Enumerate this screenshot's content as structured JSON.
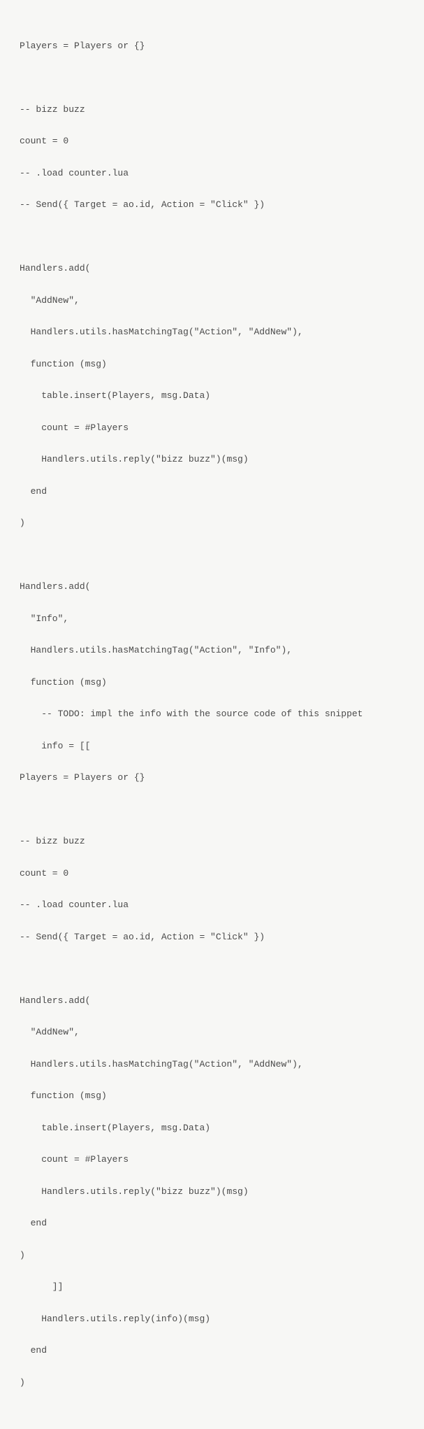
{
  "code": {
    "line1": "Players = Players or {}",
    "line2": "",
    "line3": "-- bizz buzz",
    "line4": "count = 0",
    "line5": "-- .load counter.lua",
    "line6": "-- Send({ Target = ao.id, Action = \"Click\" })",
    "line7": "",
    "line8": "Handlers.add(",
    "line9": "  \"AddNew\",",
    "line10": "  Handlers.utils.hasMatchingTag(\"Action\", \"AddNew\"),",
    "line11": "  function (msg)",
    "line12": "    table.insert(Players, msg.Data)",
    "line13": "    count = #Players",
    "line14": "    Handlers.utils.reply(\"bizz buzz\")(msg)",
    "line15": "  end",
    "line16": ")",
    "line17": "",
    "line18": "Handlers.add(",
    "line19": "  \"Info\",",
    "line20": "  Handlers.utils.hasMatchingTag(\"Action\", \"Info\"),",
    "line21": "  function (msg)",
    "line22": "    -- TODO: impl the info with the source code of this snippet",
    "line23": "    info = [[",
    "line24": "Players = Players or {}",
    "line25": "",
    "line26": "-- bizz buzz",
    "line27": "count = 0",
    "line28": "-- .load counter.lua",
    "line29": "-- Send({ Target = ao.id, Action = \"Click\" })",
    "line30": "",
    "line31": "Handlers.add(",
    "line32": "  \"AddNew\",",
    "line33": "  Handlers.utils.hasMatchingTag(\"Action\", \"AddNew\"),",
    "line34": "  function (msg)",
    "line35": "    table.insert(Players, msg.Data)",
    "line36": "    count = #Players",
    "line37": "    Handlers.utils.reply(\"bizz buzz\")(msg)",
    "line38": "  end",
    "line39": ")",
    "line40": "      ]]",
    "line41": "    Handlers.utils.reply(info)(msg)",
    "line42": "  end",
    "line43": ")"
  }
}
